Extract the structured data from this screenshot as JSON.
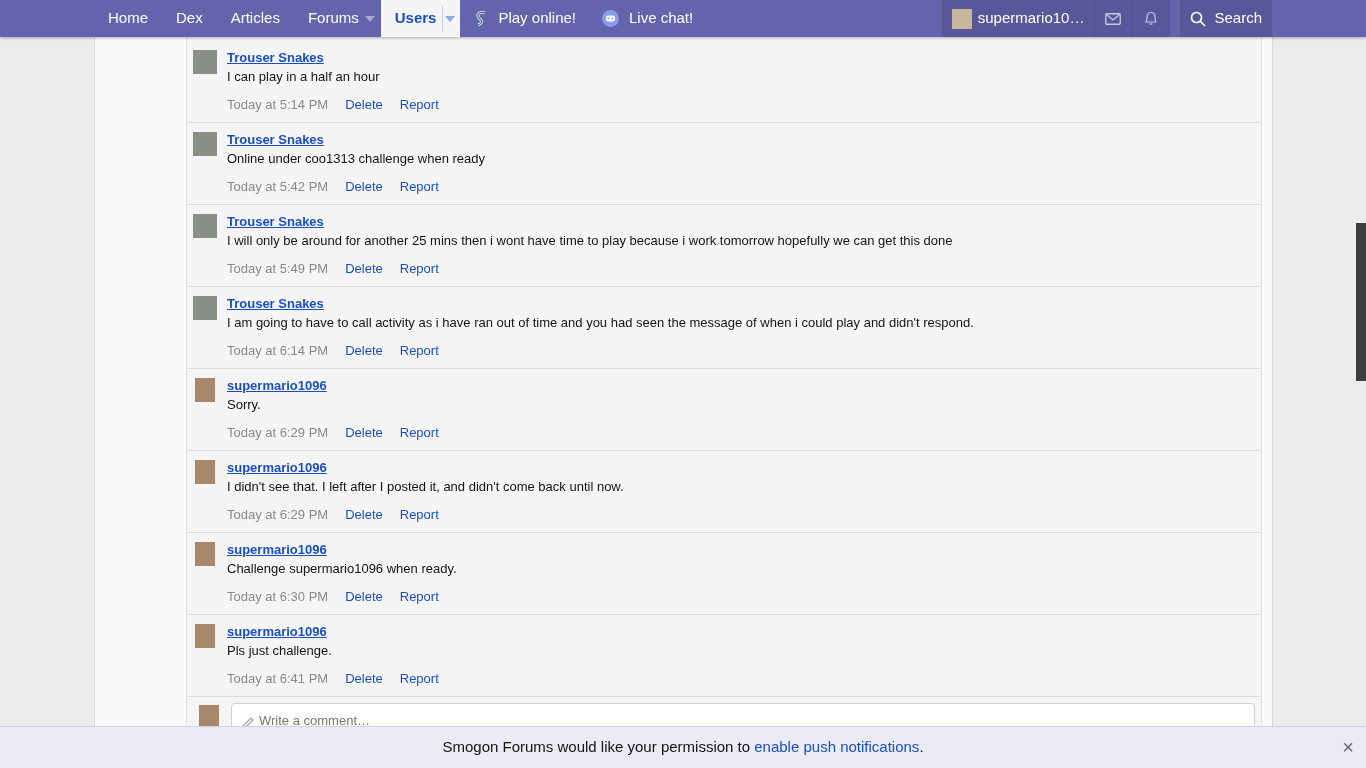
{
  "nav": {
    "items": [
      {
        "label": "Home",
        "selected": false,
        "kind": "plain"
      },
      {
        "label": "Dex",
        "selected": false,
        "kind": "plain"
      },
      {
        "label": "Articles",
        "selected": false,
        "kind": "plain"
      },
      {
        "label": "Forums",
        "selected": false,
        "kind": "dropdown"
      },
      {
        "label": "Users",
        "selected": true,
        "kind": "dropdown"
      },
      {
        "label": "Play online!",
        "selected": false,
        "kind": "play"
      },
      {
        "label": "Live chat!",
        "selected": false,
        "kind": "chat"
      }
    ],
    "user": "supermario10…",
    "search": "Search"
  },
  "comments": [
    {
      "author": "Trouser Snakes",
      "text": "I can play in a half an hour",
      "time": "Today at 5:14 PM",
      "actions": [
        "Delete",
        "Report"
      ]
    },
    {
      "author": "Trouser Snakes",
      "text": "Online under coo1313 challenge when ready",
      "time": "Today at 5:42 PM",
      "actions": [
        "Delete",
        "Report"
      ]
    },
    {
      "author": "Trouser Snakes",
      "text": "I will only be around for another 25 mins then i wont have time to play because i work tomorrow hopefully we can get this done",
      "time": "Today at 5:49 PM",
      "actions": [
        "Delete",
        "Report"
      ]
    },
    {
      "author": "Trouser Snakes",
      "text": "I am going to have to call activity as i have ran out of time and you had seen the message of when i could play and didn't respond.",
      "time": "Today at 6:14 PM",
      "actions": [
        "Delete",
        "Report"
      ]
    },
    {
      "author": "supermario1096",
      "text": "Sorry.",
      "time": "Today at 6:29 PM",
      "actions": [
        "Delete",
        "Report"
      ]
    },
    {
      "author": "supermario1096",
      "text": "I didn't see that. I left after I posted it, and didn't come back until now.",
      "time": "Today at 6:29 PM",
      "actions": [
        "Delete",
        "Report"
      ]
    },
    {
      "author": "supermario1096",
      "text": "Challenge supermario1096 when ready.",
      "time": "Today at 6:30 PM",
      "actions": [
        "Delete",
        "Report"
      ]
    },
    {
      "author": "supermario1096",
      "text": "Pls just challenge.",
      "time": "Today at 6:41 PM",
      "actions": [
        "Delete",
        "Report"
      ]
    }
  ],
  "comment_box": {
    "placeholder": "Write a comment…"
  },
  "notice": {
    "text": "Smogon Forums would like your permission to ",
    "link": "enable push notifications",
    "after": ".",
    "close": "×"
  }
}
